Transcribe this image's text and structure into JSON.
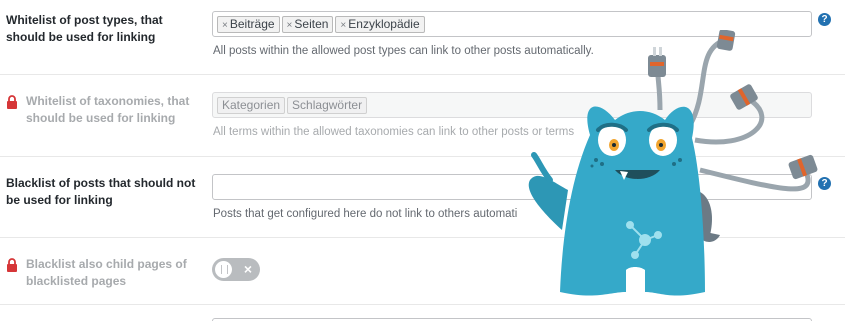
{
  "settings": {
    "row1": {
      "label": "Whitelist of post types, that should be used for linking",
      "tags": [
        "Beiträge",
        "Seiten",
        "Enzyklopädie"
      ],
      "help": "All posts within the allowed post types can link to other posts automatically."
    },
    "row2": {
      "label": "Whitelist of taxonomies, that should be used for linking",
      "tags": [
        "Kategorien",
        "Schlagwörter"
      ],
      "help": "All terms within the allowed taxonomies can link to other posts or terms"
    },
    "row3": {
      "label": "Blacklist of posts that should not be used for linking",
      "value": "",
      "help": "Posts that get configured here do not link to others automati"
    },
    "row4": {
      "label": "Blacklist also child pages of blacklisted pages",
      "toggle_state": "off"
    }
  },
  "icons": {
    "help": "question-circle-icon",
    "lock": "lock-icon",
    "remove_tag": "×",
    "toggle_off": "×",
    "help_symbol": "?"
  },
  "colors": {
    "help_icon": "#2271b1",
    "lock": "#d63638",
    "mascot": "#35a9c9"
  }
}
